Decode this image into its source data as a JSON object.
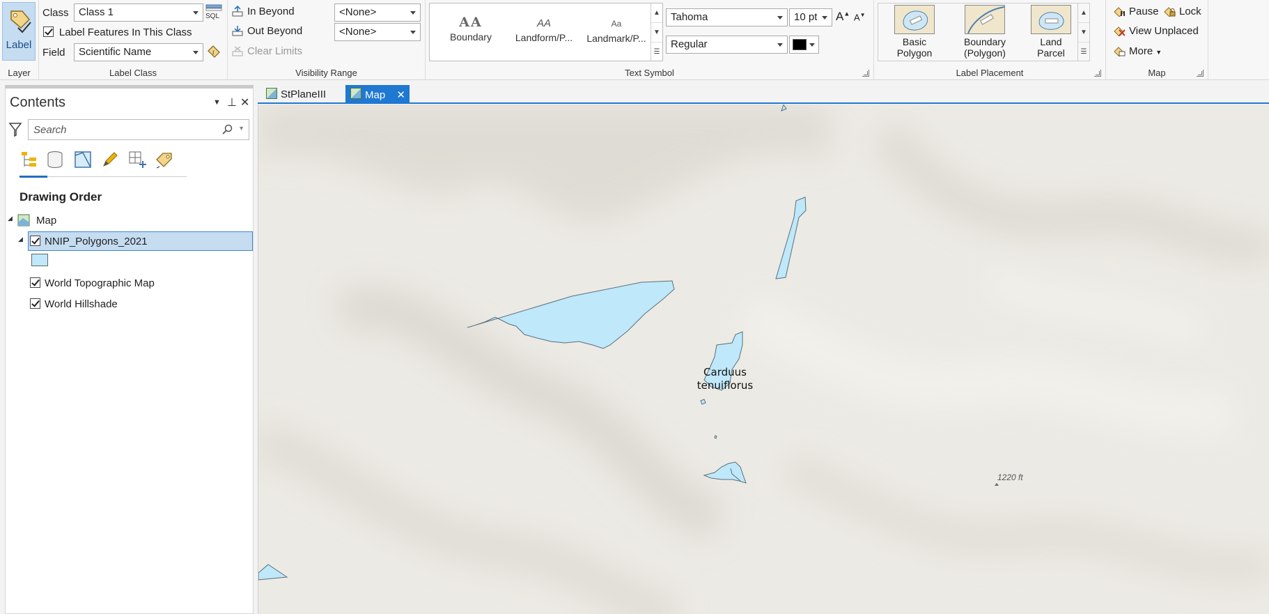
{
  "ribbon": {
    "layer": {
      "button_label": "Label",
      "group_label": "Layer"
    },
    "label_class": {
      "class_label": "Class",
      "class_value": "Class 1",
      "sql_label": "SQL",
      "label_features_label": "Label Features In This Class",
      "label_features_checked": true,
      "field_label": "Field",
      "field_value": "Scientific Name",
      "group_label": "Label Class"
    },
    "visibility_range": {
      "in_beyond_label": "In Beyond",
      "in_beyond_value": "<None>",
      "out_beyond_label": "Out Beyond",
      "out_beyond_value": "<None>",
      "clear_limits_label": "Clear Limits",
      "group_label": "Visibility Range"
    },
    "text_symbol": {
      "gallery": [
        {
          "glyph": "AA",
          "label": "Boundary"
        },
        {
          "glyph": "AA",
          "label": "Landform/P..."
        },
        {
          "glyph": "Aa",
          "label": "Landmark/P..."
        }
      ],
      "font_name": "Tahoma",
      "font_size": "10 pt",
      "font_style": "Regular",
      "color": "#000000",
      "grow_label": "A",
      "shrink_label": "A",
      "group_label": "Text Symbol"
    },
    "label_placement": {
      "items": [
        {
          "label_line1": "Basic",
          "label_line2": "Polygon"
        },
        {
          "label_line1": "Boundary",
          "label_line2": "(Polygon)"
        },
        {
          "label_line1": "Land",
          "label_line2": "Parcel"
        }
      ],
      "group_label": "Label Placement"
    },
    "map": {
      "pause_label": "Pause",
      "lock_label": "Lock",
      "view_unplaced_label": "View Unplaced",
      "more_label": "More",
      "group_label": "Map"
    }
  },
  "contents": {
    "title": "Contents",
    "search_placeholder": "Search",
    "heading": "Drawing Order",
    "tree": {
      "map_label": "Map",
      "layers": [
        {
          "name": "NNIP_Polygons_2021",
          "checked": true,
          "selected": true
        },
        {
          "name": "World Topographic Map",
          "checked": true
        },
        {
          "name": "World Hillshade",
          "checked": true
        }
      ],
      "symbol_color": "#bfe8fa"
    }
  },
  "view": {
    "tabs": [
      {
        "label": "StPlaneIII",
        "active": false
      },
      {
        "label": "Map",
        "active": true,
        "close": "✕"
      }
    ],
    "feature_label_line1": "Carduus",
    "feature_label_line2": "tenuiflorus",
    "elevation_label": "1220 ft",
    "polygon_fill": "#bfe8fa",
    "accent": "#1f78d1"
  }
}
